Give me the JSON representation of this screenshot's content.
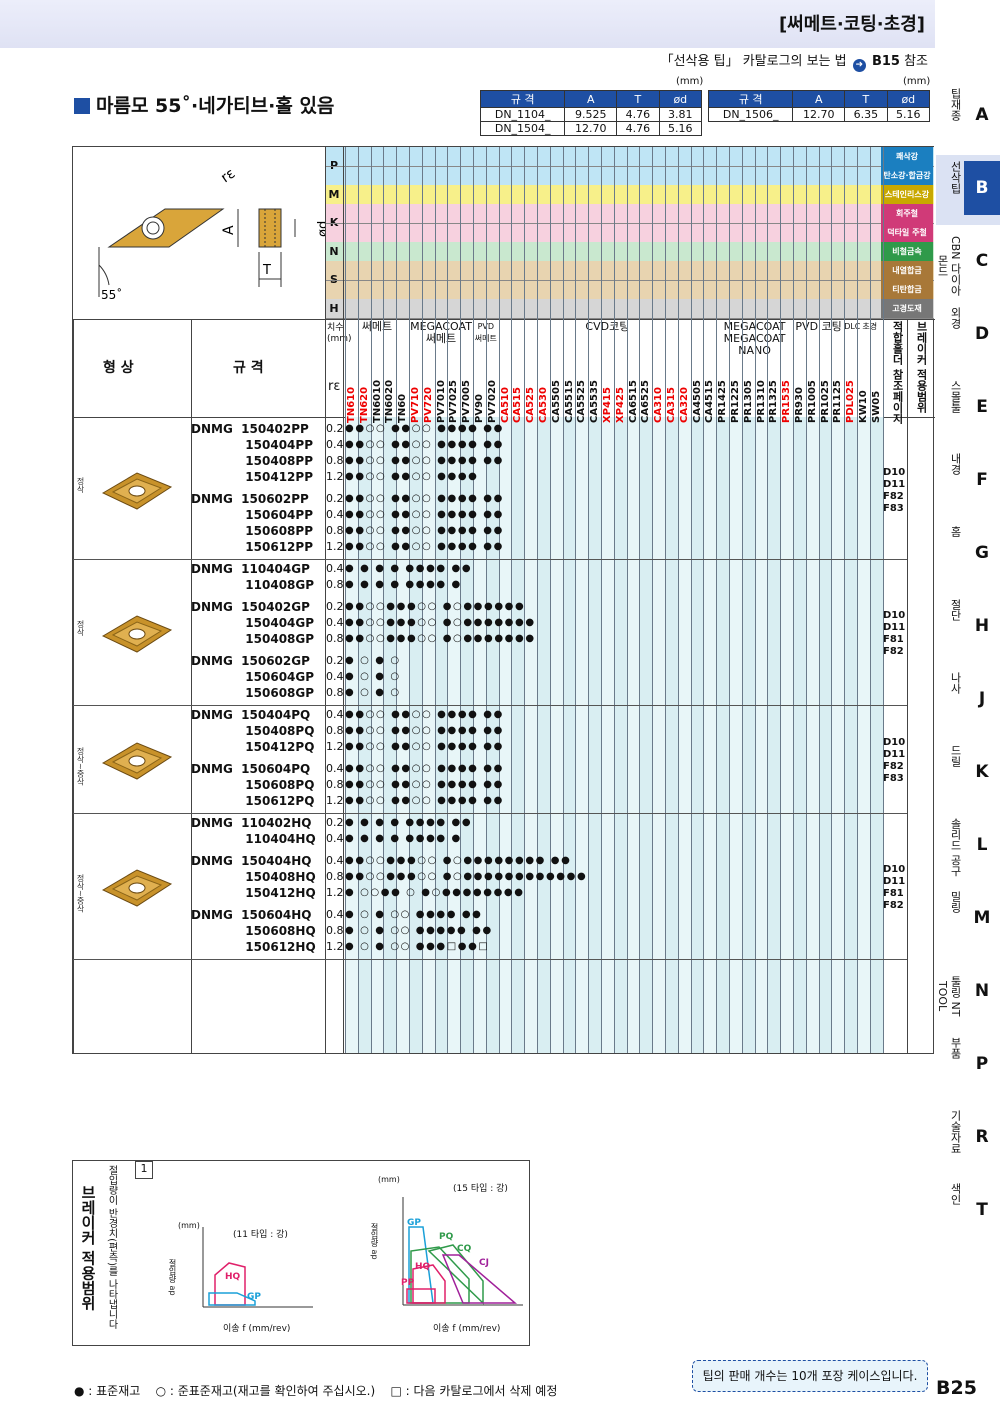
{
  "header": {
    "title": "[써메트·코팅·초경]",
    "ref_text": "「선삭용 팁」 카탈로그의 보는 법",
    "ref_page": "B15",
    "ref_suffix": "참조"
  },
  "section": {
    "title": "마름모 55˚·네가티브·홀 있음"
  },
  "spec_tables": [
    {
      "unit": "(mm)",
      "headers": [
        "규 격",
        "A",
        "T",
        "ød"
      ],
      "rows": [
        [
          "DN_1104_",
          "9.525",
          "4.76",
          "3.81"
        ],
        [
          "DN_1504_",
          "12.70",
          "4.76",
          "5.16"
        ]
      ]
    },
    {
      "unit": "(mm)",
      "headers": [
        "규 격",
        "A",
        "T",
        "ød"
      ],
      "rows": [
        [
          "DN_1506_",
          "12.70",
          "6.35",
          "5.16"
        ]
      ]
    }
  ],
  "diagram": {
    "label_re": "rε",
    "label_A": "A",
    "label_T": "T",
    "label_d": "ød",
    "label_angle": "55˚"
  },
  "materials": [
    {
      "code": "P",
      "labels": [
        "쾌삭강",
        "탄소강·합금강"
      ],
      "color": "#bfe5f5",
      "label_color": "#1b7fc0"
    },
    {
      "code": "M",
      "labels": [
        "스테인리스강"
      ],
      "color": "#f7f08a",
      "label_color": "#c8a800"
    },
    {
      "code": "K",
      "labels": [
        "회주철",
        "덕타일 주철"
      ],
      "color": "#f7d1df",
      "label_color": "#d03a78"
    },
    {
      "code": "N",
      "labels": [
        "비철금속"
      ],
      "color": "#c9e8cf",
      "label_color": "#2f9a4a"
    },
    {
      "code": "S",
      "labels": [
        "내열합금",
        "티탄합금"
      ],
      "color": "#e8d4b0",
      "label_color": "#a87838"
    },
    {
      "code": "H",
      "labels": [
        "고경도재"
      ],
      "color": "#d6d6d6",
      "label_color": "#777"
    }
  ],
  "columns": {
    "shape": "형 상",
    "spec": "규 격",
    "dim": "치수\n(mm)",
    "re": "rε",
    "groups": [
      "써메트",
      "MEGACOAT 써메트",
      "PVD 써메트",
      "CVD코팅",
      "MEGACOAT MEGACOAT NANO",
      "PVD 코팅",
      "DLC",
      "초경",
      "적합홀더 참조페이지",
      "브레이커 적용범위"
    ],
    "grades": [
      "TN610",
      "TN620",
      "TN6010",
      "TN6020",
      "TN60",
      "PV710",
      "PV720",
      "PV7010",
      "PV7025",
      "PV7005",
      "PV90",
      "PV7020",
      "CA510",
      "CA515",
      "CA525",
      "CA530",
      "CA5505",
      "CA5515",
      "CA5525",
      "CA5535",
      "XP415",
      "XP425",
      "CA6515",
      "CA6525",
      "CA310",
      "CA315",
      "CA320",
      "CA4505",
      "CA4515",
      "PR1425",
      "PR1225",
      "PR1305",
      "PR1310",
      "PR1325",
      "PR1535",
      "PR930",
      "PR1005",
      "PR1025",
      "PR1125",
      "PDL025",
      "KW10",
      "SW05"
    ]
  },
  "groups": [
    {
      "side": "정삭",
      "rows": [
        {
          "code": "DNMG  150402PP",
          "re": "0.2",
          "sym": "●●○○  ●●○○         ●●●●  ●●"
        },
        {
          "code": "150404PP",
          "re": "0.4",
          "sym": "●●○○  ●●○○         ●●●●  ●●"
        },
        {
          "code": "150408PP",
          "re": "0.8",
          "sym": "●●○○  ●●○○         ●●●●  ●●"
        },
        {
          "code": "150412PP",
          "re": "1.2",
          "sym": "●●○○  ●●○○         ●●●●"
        },
        {
          "code": "DNMG  150602PP",
          "re": "0.2",
          "sym": "●●○○  ●●○○         ●●●●  ●●"
        },
        {
          "code": "150604PP",
          "re": "0.4",
          "sym": "●●○○  ●●○○         ●●●●  ●●"
        },
        {
          "code": "150608PP",
          "re": "0.8",
          "sym": "●●○○  ●●○○         ●●●●  ●●"
        },
        {
          "code": "150612PP",
          "re": "1.2",
          "sym": "●●○○  ●●○○         ●●●●  ●●"
        }
      ],
      "brk": [
        "D10",
        "D11",
        "F82",
        "F83"
      ]
    },
    {
      "side": "정삭",
      "rows": [
        {
          "code": "DNMG  110404GP",
          "re": "0.4",
          "sym": "  ●    ●   ●      ●  ●●●●  ●●"
        },
        {
          "code": "110408GP",
          "re": "0.8",
          "sym": "  ●    ●   ●      ●  ●●●●   ●"
        },
        {
          "code": "DNMG  150402GP",
          "re": "0.2",
          "sym": "●●○○●●●○○   ●○●●●●●●"
        },
        {
          "code": "150404GP",
          "re": "0.4",
          "sym": "●●○○●●●○○   ●○●●●●●●●"
        },
        {
          "code": "150408GP",
          "re": "0.8",
          "sym": "●●○○●●●○○   ●○●●●●●●●"
        },
        {
          "code": "DNMG  150602GP",
          "re": "0.2",
          "sym": "●   ○     ●   ○"
        },
        {
          "code": "150604GP",
          "re": "0.4",
          "sym": "●   ○     ●   ○"
        },
        {
          "code": "150608GP",
          "re": "0.8",
          "sym": "●   ○     ●   ○"
        }
      ],
      "brk": [
        "D10",
        "D11",
        "F81",
        "F82"
      ]
    },
    {
      "side": "정삭~중삭",
      "rows": [
        {
          "code": "DNMG  150404PQ",
          "re": "0.4",
          "sym": "●●○○  ●●○○         ●●●●  ●●"
        },
        {
          "code": "150408PQ",
          "re": "0.8",
          "sym": "●●○○  ●●○○         ●●●●  ●●"
        },
        {
          "code": "150412PQ",
          "re": "1.2",
          "sym": "●●○○  ●●○○         ●●●●  ●●"
        },
        {
          "code": "DNMG  150604PQ",
          "re": "0.4",
          "sym": "●●○○  ●●○○         ●●●●  ●●"
        },
        {
          "code": "150608PQ",
          "re": "0.8",
          "sym": "●●○○  ●●○○         ●●●●  ●●"
        },
        {
          "code": "150612PQ",
          "re": "1.2",
          "sym": "●●○○  ●●○○         ●●●●  ●●"
        }
      ],
      "brk": [
        "D10",
        "D11",
        "F82",
        "F83"
      ]
    },
    {
      "side": "정삭~중삭",
      "rows": [
        {
          "code": "DNMG  110402HQ",
          "re": "0.2",
          "sym": "  ●    ●   ●      ●  ●●●●  ●●"
        },
        {
          "code": "110404HQ",
          "re": "0.4",
          "sym": "  ●    ●   ●      ●  ●●●●   ●"
        },
        {
          "code": "DNMG  150404HQ",
          "re": "0.4",
          "sym": "●●○○●●●○○   ●○●●●●●●●●   ●●"
        },
        {
          "code": "150408HQ",
          "re": "0.8",
          "sym": "●●○○●●●○○   ●○●●●●●●●●●●●●"
        },
        {
          "code": "150412HQ",
          "re": "1.2",
          "sym": "●  ○○●●   ○   ●○●●●●●●●●"
        },
        {
          "code": "DNMG  150604HQ",
          "re": "0.4",
          "sym": "●   ○     ●   ○○   ●●●●   ●●"
        },
        {
          "code": "150608HQ",
          "re": "0.8",
          "sym": "●   ○     ●   ○○   ●●●●●   ●●"
        },
        {
          "code": "150612HQ",
          "re": "1.2",
          "sym": "●   ○     ●   ○○   ●●●□●●□"
        }
      ],
      "brk": [
        "D10",
        "D11",
        "F81",
        "F82"
      ]
    }
  ],
  "breaker": {
    "title": "브레이커 적용범위",
    "note_no": "1",
    "note": "절입량이 반경치(편측)를 나타냅니다",
    "chart_11": {
      "caption": "(11 타입 : 강)",
      "unit": "(mm)",
      "xlabel": "이송 f (mm/rev)",
      "ylabel": "절입량 ap",
      "labels": [
        "HQ",
        "GP"
      ]
    },
    "chart_15": {
      "caption": "(15 타입 : 강)",
      "unit": "(mm)",
      "xlabel": "이송 f (mm/rev)",
      "ylabel": "절입량 ap",
      "labels": [
        "GP",
        "PQ",
        "CQ",
        "CJ",
        "HQ",
        "PP"
      ]
    }
  },
  "footnote": {
    "std": "● : 표준재고",
    "semi": "○ : 준표준재고(재고를 확인하여 주십시오.)",
    "del": "□ : 다음 카탈로그에서 삭제 예정"
  },
  "pack_note": "팁의 판매 개수는 10개 포장 케이스입니다.",
  "page_no": "B25",
  "tabs": [
    {
      "label": "팁재종",
      "letter": "A"
    },
    {
      "label": "선삭팁",
      "letter": "B",
      "active": true
    },
    {
      "label": "CBN 다이아몬드",
      "letter": "C"
    },
    {
      "label": "외경",
      "letter": "D"
    },
    {
      "label": "스몰툴",
      "letter": "E"
    },
    {
      "label": "내경",
      "letter": "F"
    },
    {
      "label": "홈",
      "letter": "G"
    },
    {
      "label": "절단",
      "letter": "H"
    },
    {
      "label": "나사",
      "letter": "J"
    },
    {
      "label": "드릴",
      "letter": "K"
    },
    {
      "label": "솔리드 공구",
      "letter": "L"
    },
    {
      "label": "밀링",
      "letter": "M"
    },
    {
      "label": "툴링 NT TOOL",
      "letter": "N"
    },
    {
      "label": "부품",
      "letter": "P"
    },
    {
      "label": "기술자료",
      "letter": "R"
    },
    {
      "label": "색인",
      "letter": "T"
    }
  ]
}
